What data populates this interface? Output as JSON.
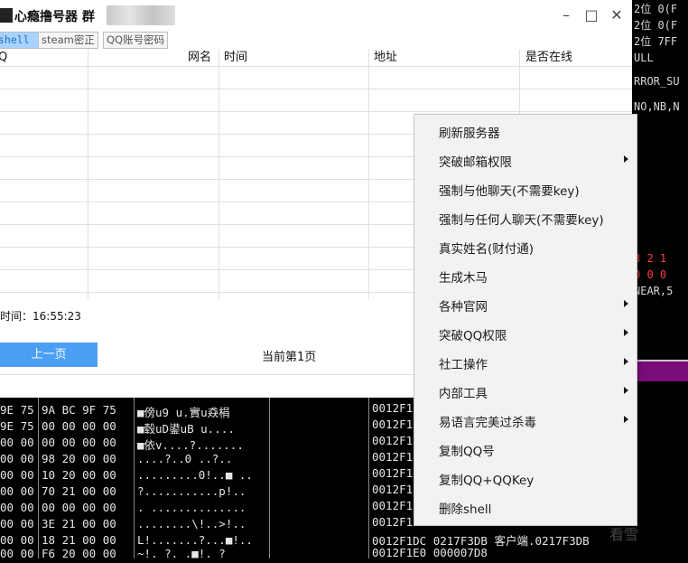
{
  "window": {
    "title": "心瘾撸号器 群",
    "minimize_glyph": "–",
    "maximize_glyph": "□",
    "close_glyph": "✕"
  },
  "tabs": [
    {
      "label": "shell",
      "active": true
    },
    {
      "label": "steam密正",
      "active": false
    },
    {
      "label": "QQ账号密码",
      "active": false
    }
  ],
  "table": {
    "columns": [
      "Q",
      "网名",
      "时间",
      "地址",
      "是否在线"
    ]
  },
  "time_label": "时间：16:55:23",
  "pager": {
    "prev_label": "上一页",
    "current_label": "当前第1页"
  },
  "context_menu": [
    {
      "label": "刷新服务器",
      "submenu": false
    },
    {
      "label": "突破邮箱权限",
      "submenu": true
    },
    {
      "label": "强制与他聊天(不需要key)",
      "submenu": false
    },
    {
      "label": "强制与任何人聊天(不需要key)",
      "submenu": false
    },
    {
      "label": "真实姓名(财付通)",
      "submenu": false
    },
    {
      "label": "生成木马",
      "submenu": false
    },
    {
      "label": "各种官网",
      "submenu": true
    },
    {
      "label": "突破QQ权限",
      "submenu": true
    },
    {
      "label": "社工操作",
      "submenu": true
    },
    {
      "label": "内部工具",
      "submenu": true
    },
    {
      "label": "易语言完美过杀毒",
      "submenu": true
    },
    {
      "label": "复制QQ号",
      "submenu": false
    },
    {
      "label": "复制QQ+QQKey",
      "submenu": false
    },
    {
      "label": "删除shell",
      "submenu": false
    }
  ],
  "debugger_right": [
    "2位 0(F",
    "2位 0(F",
    "2位 7FF",
    "ULL",
    "RROR_SU",
    "NO,NB,N",
    "3 2 1",
    "0 0 0",
    "NEAR,5"
  ],
  "hex_dump": [
    {
      "addr": "9E 75",
      "bytes": "9A BC 9F 75",
      "ascii": "■傍u9  u.實u猋梋"
    },
    {
      "addr": "9E 75",
      "bytes": "00 00 00 00",
      "ascii": "■毂uD鍙uB  u...."
    },
    {
      "addr": "00 00",
      "bytes": "00 00 00 00",
      "ascii": "■依v....?......."
    },
    {
      "addr": "00 00",
      "bytes": "98 20 00 00",
      "ascii": "....?..0 ..?.."
    },
    {
      "addr": "00 00",
      "bytes": "10 20 00 00",
      "ascii": ".........0!..■ .."
    },
    {
      "addr": "00 00",
      "bytes": "70 21 00 00",
      "ascii": "?...........p!.."
    },
    {
      "addr": "00 00",
      "bytes": "00 00 00 00",
      "ascii": ". .............."
    },
    {
      "addr": "00 00",
      "bytes": "3E 21 00 00",
      "ascii": "........\\!..>!.."
    },
    {
      "addr": "00 00",
      "bytes": "18 21 00 00",
      "ascii": "L!.......?...■!.."
    },
    {
      "addr": "00 00",
      "bytes": "F6 20 00 00",
      "ascii": "~!.  ?. .■!. ?"
    }
  ],
  "stack": [
    "0012F1",
    "0012F1",
    "0012F1",
    "0012F1",
    "0012F1",
    "0012F1",
    "0012F1",
    "0012F1",
    "0012F1DC  0217F3DB  客户端.0217F3DB",
    "0012F1E0  000007D8"
  ],
  "watermark": "看雪"
}
